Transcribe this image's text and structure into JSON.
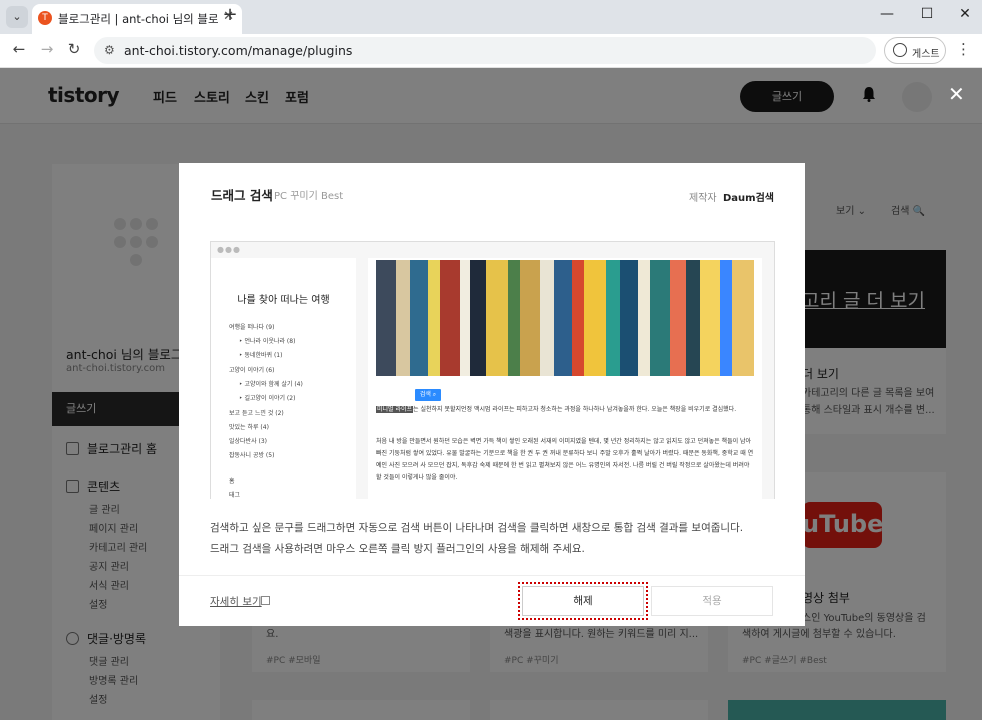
{
  "browser": {
    "tab_title": "블로그관리 | ant-choi 님의 블로그",
    "tab_favicon": "T",
    "url": "ant-choi.tistory.com/manage/plugins",
    "guest_label": "게스트"
  },
  "header": {
    "logo": "tistory",
    "nav": [
      "피드",
      "스토리",
      "스킨",
      "포럼"
    ],
    "write_label": "글쓰기"
  },
  "sidebar": {
    "blog_name": "ant-choi 님의 블로그",
    "blog_url": "ant-choi.tistory.com",
    "write_label": "글쓰기",
    "home_label": "블로그관리 홈",
    "content_label": "콘텐츠",
    "content_items": [
      "글 관리",
      "페이지 관리",
      "카테고리 관리",
      "공지 관리",
      "서식 관리",
      "설정"
    ],
    "comments_label": "댓글·방명록",
    "comments_items": [
      "댓글 관리",
      "방명록 관리",
      "설정"
    ]
  },
  "background": {
    "view_label": "보기",
    "search_label": "검색",
    "card1_banner": "고리 글 더 보기",
    "card1_title": "더 보기",
    "card1_lines": [
      "카테고리의 다른 글 목록을 보여",
      "통해 스타일과 표시 개수를 변..."
    ],
    "card2_banner": "uTube",
    "card2_title": "영상 첨부",
    "card2_lines": [
      "스인 YouTube의 동영상을 검",
      "색하여 게시글에 첨부할 수 있습니다."
    ],
    "card2_tags": "#PC  #글쓰기  #Best",
    "card3_line": "요.",
    "card3_tags": "#PC  #모바일",
    "card4_line": "색광을 표시합니다. 원하는 키워드를 미리 지...",
    "card4_tags": "#PC  #꾸미기"
  },
  "modal": {
    "title": "드래그 검색",
    "subtitle": "PC 꾸미기 Best",
    "maker_label": "제작자",
    "maker_name": "Daum검색",
    "description_1": "검색하고 싶은 문구를 드래그하면 자동으로 검색 버튼이 나타나며 검색을 클릭하면 새창으로 통합 검색 결과를 보여줍니다.",
    "description_2": "드래그 검색을 사용하려면 마우스 오른쪽 클릭 방지 플러그인의 사용을 해제해 주세요.",
    "detail_link": "자세히 보기",
    "disable_button": "해제",
    "apply_button": "적용"
  },
  "preview": {
    "blog_title": "나를 찾아 떠나는 여행",
    "categories": [
      "여행을 떠나다 (9)",
      "언나라 이웃나라 (8)",
      "동네한바퀴 (1)",
      "고양이 이야기 (6)",
      "고양이와 함께 살기 (4)",
      "길고양이 이야기 (2)",
      "보고 듣고 느낀 것 (2)",
      "맛있는 하루 (4)",
      "일상다반사 (3)",
      "잡동사니 공방 (5)",
      "홈",
      "태그"
    ],
    "search_popup": "검색",
    "highlight": "미니멀 라이프",
    "para1": "는 실천하지 못할지언정 맥시멈 라이프는 피하고자 청소하는 과정을 하나하나 남겨놓을까 한다. 오늘은 책장을 비우기로 결심했다.",
    "para2": "처음 내 방을 만들면서 원하던 모습은 벽면 가득 책이 쌓인 오래된 서재의 이미지였을 텐데, 몇 년간 정리하지는 않고 읽지도 않고 던져놓은 책들이 남아빠진 기둥처럼 쌓여 있었다. 유물 발굴하는 기분으로 책을 한 권 두 권 꺼내 분류하다 보니 주말 오후가 훌쩍 날아가 버렸다. 때문은 동화책, 중학교 때 연예인 사진 모으려 사 모으던 잡지, 독후감 숙제 때문에 한 번 읽고 펼쳐보지 않은 어느 유명인의 자서전. 나름 버릴 건 버릴 작정으로 살아왔는데 버려야 할 것들이 이렇게나 많을 줄이야."
  }
}
